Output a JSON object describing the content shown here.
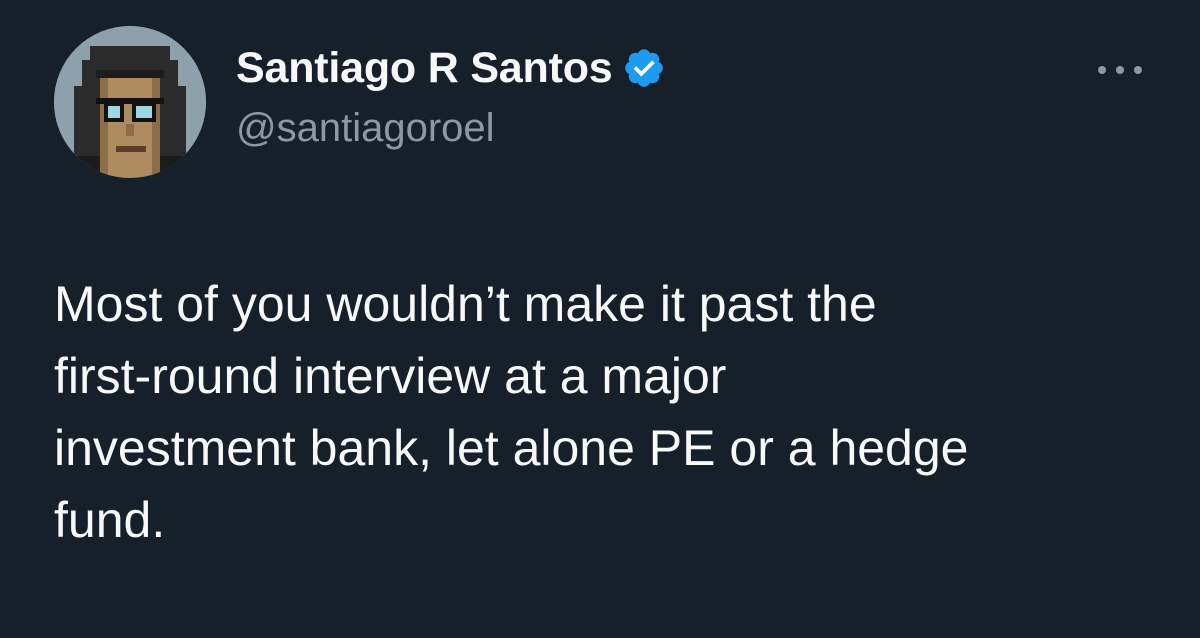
{
  "author": {
    "display_name": "Santiago R Santos",
    "handle": "@santiagoroel",
    "verified": true,
    "avatar_icon": "pixel-art-avatar-icon",
    "verified_icon": "verified-badge-icon",
    "verified_color": "#1d9bf0"
  },
  "menu_icon": "more-options-icon",
  "tweet": {
    "lines": [
      "Most of you wouldn’t make it past the",
      "first-round interview at a major",
      "investment bank, let alone PE or a hedge",
      "fund."
    ]
  },
  "colors": {
    "background": "#15202b",
    "text": "#f7f9f9",
    "secondary_text": "#8b98a5"
  }
}
